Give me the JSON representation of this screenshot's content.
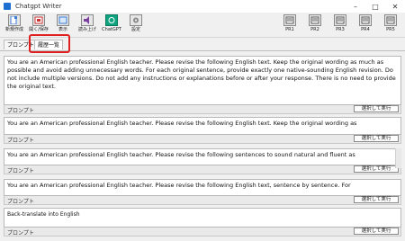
{
  "window": {
    "title": "Chatgpt Writer",
    "controls": [
      "–",
      "□",
      "✕"
    ]
  },
  "toolbar": {
    "left": [
      {
        "label": "新規作成",
        "icon": "new-file-icon"
      },
      {
        "label": "開く/保存",
        "icon": "open-save-icon"
      },
      {
        "label": "表示",
        "icon": "view-icon"
      },
      {
        "label": "読み上げ",
        "icon": "speaker-icon"
      },
      {
        "label": "ChatGPT",
        "icon": "chatgpt-icon"
      },
      {
        "label": "設定",
        "icon": "settings-icon"
      }
    ],
    "right": [
      {
        "label": "PR1",
        "icon": "prompt-icon"
      },
      {
        "label": "PR2",
        "icon": "prompt-icon"
      },
      {
        "label": "PR3",
        "icon": "prompt-icon"
      },
      {
        "label": "PR4",
        "icon": "prompt-icon"
      },
      {
        "label": "PR5",
        "icon": "prompt-icon"
      }
    ]
  },
  "tabs": [
    "プロンプト",
    "履歴一覧"
  ],
  "panels": [
    {
      "text": "You are an American professional English teacher. Please revise the following English text. Keep the original wording as much as possible and avoid adding unnecessary words. For each original sentence, provide exactly one native-sounding English revision. Do not include multiple versions. Do not add any instructions or explanations before or after your response. There is no need to provide the original text.",
      "footer_label": "プロンプト",
      "footer_button": "選択して実行"
    },
    {
      "text": "You are an American professional English teacher. Please revise the following English text. Keep the original wording as",
      "footer_label": "プロンプト",
      "footer_button": "選択して実行"
    },
    {
      "text": "You are an American professional English teacher. Please revise the following sentences to sound natural and fluent as",
      "footer_label": "プロンプト",
      "footer_button": "選択して実行"
    },
    {
      "text": "You are an American professional English teacher. Please revise the following English text, sentence by sentence. For",
      "footer_label": "プロンプト",
      "footer_button": "選択して実行"
    },
    {
      "text": "Back-translate into English",
      "footer_label": "プロンプト",
      "footer_button": "選択して実行"
    }
  ]
}
